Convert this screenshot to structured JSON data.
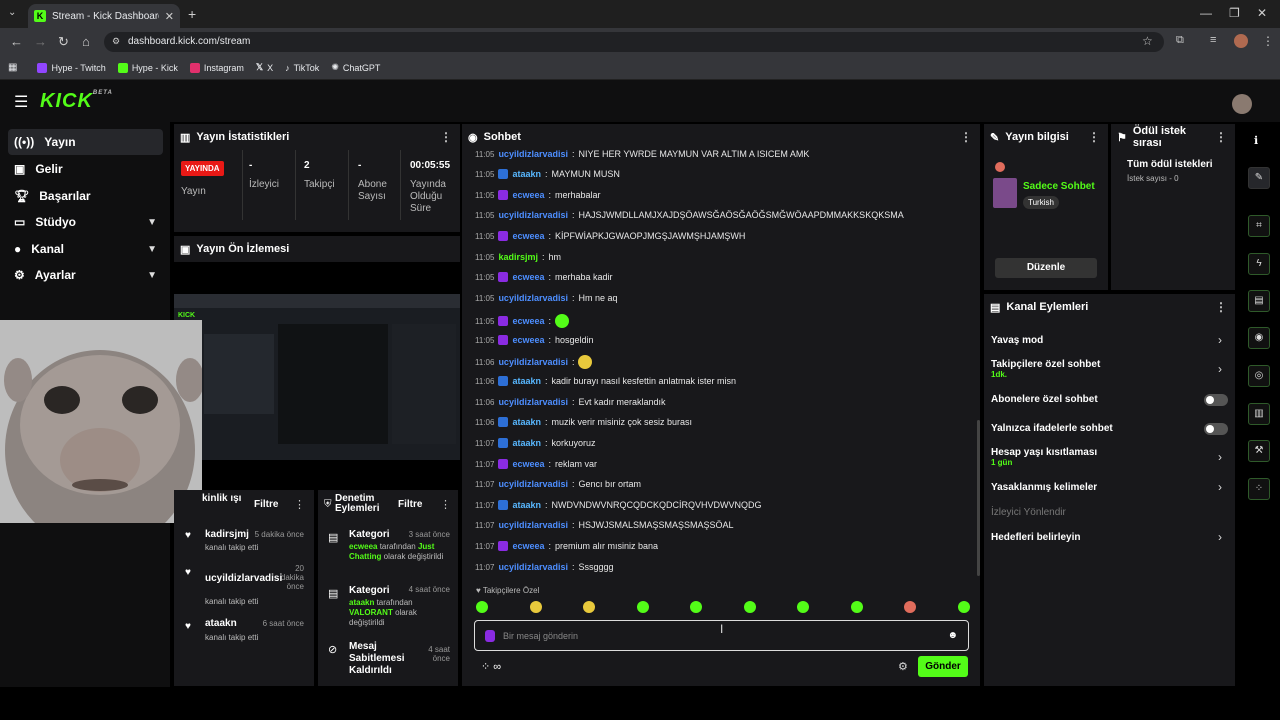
{
  "browser": {
    "tab_title": "Stream - Kick Dashboard",
    "url": "dashboard.kick.com/stream",
    "bookmarks": [
      {
        "label": "Hype - Twitch",
        "color": "#9146ff"
      },
      {
        "label": "Hype - Kick",
        "color": "#53fc18"
      },
      {
        "label": "Instagram",
        "color": "#e1306c"
      },
      {
        "label": "X",
        "color": "#ffffff"
      },
      {
        "label": "TikTok",
        "color": "#ffffff"
      },
      {
        "label": "ChatGPT",
        "color": "#cccccc"
      }
    ]
  },
  "app": {
    "logo": "KICK",
    "logo_sup": "BETA"
  },
  "sidebar": {
    "items": [
      {
        "label": "Yayın",
        "icon": "broadcast-icon"
      },
      {
        "label": "Gelir",
        "icon": "money-icon"
      },
      {
        "label": "Başarılar",
        "icon": "trophy-icon"
      },
      {
        "label": "Stüdyo",
        "icon": "studio-icon"
      },
      {
        "label": "Kanal",
        "icon": "person-icon"
      },
      {
        "label": "Ayarlar",
        "icon": "gear-icon"
      }
    ]
  },
  "stats": {
    "title": "Yayın İstatistikleri",
    "badge": "YAYINDA",
    "badge_label": "Yayın",
    "viewers_val": "-",
    "viewers_lbl": "İzleyici",
    "followers_val": "2",
    "followers_lbl": "Takipçi",
    "subs_val": "-",
    "subs_lbl": "Abone Sayısı",
    "uptime_val": "00:05:55",
    "uptime_lbl": "Yayında Olduğu Süre"
  },
  "preview": {
    "title": "Yayın Ön İzlemesi"
  },
  "followers_panel": {
    "title": "kinlik ışı",
    "filter": "Filtre",
    "items": [
      {
        "name": "kadirsjmj",
        "time": "5 dakika önce",
        "sub": "kanalı takip etti"
      },
      {
        "name": "ucyildizlarvadisi",
        "time": "20 dakika önce",
        "sub": "kanalı takip etti"
      },
      {
        "name": "ataakn",
        "time": "6 saat önce",
        "sub": "kanalı takip etti"
      }
    ]
  },
  "audit_panel": {
    "title": "Denetim Eylemleri",
    "filter": "Filtre",
    "items": [
      {
        "title": "Kategori",
        "time": "3 saat önce",
        "user": "ecweea",
        "pre": " tarafından ",
        "cat": "Just Chatting",
        "post": " olarak değiştirildi"
      },
      {
        "title": "Kategori",
        "time": "4 saat önce",
        "user": "ataakn",
        "pre": " tarafından ",
        "cat": "VALORANT",
        "post": " olarak değiştirildi"
      },
      {
        "title": "Mesaj Sabitlemesi Kaldırıldı",
        "time": "4 saat önce"
      }
    ]
  },
  "chat": {
    "title": "Sohbet",
    "messages": [
      {
        "time": "11:05",
        "user": "ucyildizlarvadisi",
        "color": "u-blue",
        "badge": "",
        "text": "NIYE HER YWRDE MAYMUN VAR ALTIM A ISICEM AMK"
      },
      {
        "time": "11:05",
        "user": "ataakn",
        "color": "u-cyan",
        "badge": "#2d6fd6",
        "text": "MAYMUN MUSN"
      },
      {
        "time": "11:05",
        "user": "ecweea",
        "color": "u-blue",
        "badge": "#8a2be2",
        "text": "merhabalar"
      },
      {
        "time": "11:05",
        "user": "ucyildizlarvadisi",
        "color": "u-blue",
        "badge": "",
        "text": "HAJSJWMDLLAMJXAJDŞÖAWSĞAÖSĞAÖĞSMĞWÖAAPDMMAKKSKQKSMA"
      },
      {
        "time": "11:05",
        "user": "ecweea",
        "color": "u-blue",
        "badge": "#8a2be2",
        "text": "KİPFWİAPKJGWAOPJMGŞJAWMŞHJAMŞWH"
      },
      {
        "time": "11:05",
        "user": "kadirsjmj",
        "color": "u-green",
        "badge": "",
        "text": "hm"
      },
      {
        "time": "11:05",
        "user": "ecweea",
        "color": "u-blue",
        "badge": "#8a2be2",
        "text": "merhaba kadir"
      },
      {
        "time": "11:05",
        "user": "ucyildizlarvadisi",
        "color": "u-blue",
        "badge": "",
        "text": "Hm ne aq"
      },
      {
        "time": "11:05",
        "user": "ecweea",
        "color": "u-blue",
        "badge": "#8a2be2",
        "text": "",
        "emote": true
      },
      {
        "time": "11:05",
        "user": "ecweea",
        "color": "u-blue",
        "badge": "#8a2be2",
        "text": "hosgeldin"
      },
      {
        "time": "11:06",
        "user": "ucyildizlarvadisi",
        "color": "u-blue",
        "badge": "",
        "text": "",
        "emote": true
      },
      {
        "time": "11:06",
        "user": "ataakn",
        "color": "u-cyan",
        "badge": "#2d6fd6",
        "text": "kadir burayı nasıl kesfettin anlatmak ister misn"
      },
      {
        "time": "11:06",
        "user": "ucyildizlarvadisi",
        "color": "u-blue",
        "badge": "",
        "text": "Evt kadır meraklandık"
      },
      {
        "time": "11:06",
        "user": "ataakn",
        "color": "u-cyan",
        "badge": "#2d6fd6",
        "text": "muzik verir misiniz çok sesiz burası"
      },
      {
        "time": "11:07",
        "user": "ataakn",
        "color": "u-cyan",
        "badge": "#2d6fd6",
        "text": "korkuyoruz"
      },
      {
        "time": "11:07",
        "user": "ecweea",
        "color": "u-blue",
        "badge": "#8a2be2",
        "text": "reklam var"
      },
      {
        "time": "11:07",
        "user": "ucyildizlarvadisi",
        "color": "u-blue",
        "badge": "",
        "text": "Gencı bır ortam"
      },
      {
        "time": "11:07",
        "user": "ataakn",
        "color": "u-cyan",
        "badge": "#2d6fd6",
        "text": "NWDVNDWVNRQCQDCKQDCİRQVHVDWVNQDG"
      },
      {
        "time": "11:07",
        "user": "ucyildizlarvadisi",
        "color": "u-blue",
        "badge": "",
        "text": "HSJWJSMALSMAŞSMAŞSMAŞSÖAL"
      },
      {
        "time": "11:07",
        "user": "ecweea",
        "color": "u-blue",
        "badge": "#8a2be2",
        "text": "premium alır mısiniz bana"
      },
      {
        "time": "11:07",
        "user": "ucyildizlarvadisi",
        "color": "u-blue",
        "badge": "",
        "text": "Sssgggg"
      }
    ],
    "followers_only": "Takipçilere Özel",
    "placeholder": "Bir mesaj gönderin",
    "send": "Gönder"
  },
  "stream_info": {
    "title": "Yayın bilgisi",
    "stream_name": "Sadece Sohbet",
    "language": "Turkish",
    "edit": "Düzenle"
  },
  "rewards": {
    "title": "Ödül istek sırası",
    "all": "Tüm ödül istekleri",
    "count": "İstek sayısı - 0"
  },
  "channel_actions": {
    "title": "Kanal Eylemleri",
    "slow_mode": "Yavaş mod",
    "followers_chat": "Takipçilere özel sohbet",
    "followers_chat_sub": "1dk.",
    "subs_chat": "Abonelere özel sohbet",
    "emote_chat": "Yalnızca ifadelerle sohbet",
    "account_age": "Hesap yaşı kısıtlaması",
    "account_age_sub": "1 gün",
    "banned_words": "Yasaklanmış kelimeler",
    "viewer_redirect": "İzleyici Yönlendir",
    "goals": "Hedefleri belirleyin"
  }
}
